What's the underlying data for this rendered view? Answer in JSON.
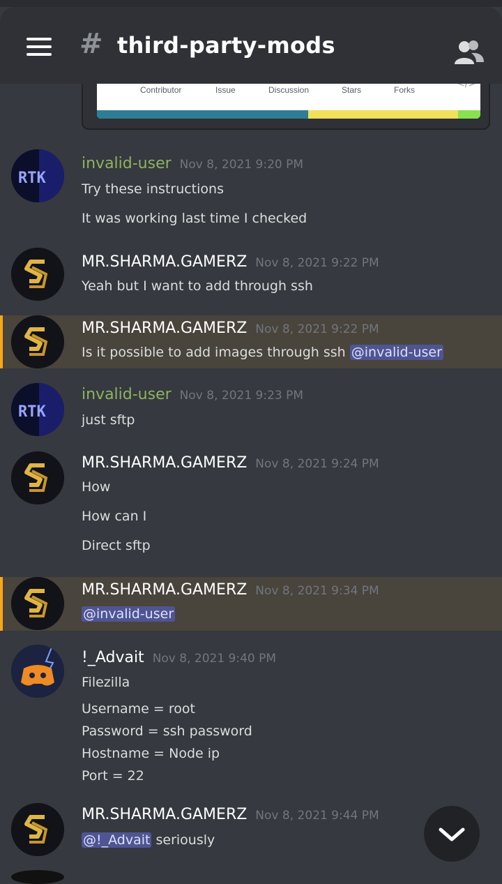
{
  "header": {
    "channel_name": "third-party-mods",
    "menu_icon": "hamburger-menu-icon",
    "channel_icon": "hash-icon",
    "members_icon": "members-icon"
  },
  "embed": {
    "stats": [
      "Contributor",
      "Issue",
      "Discussion",
      "Stars",
      "Forks"
    ],
    "bar_colors": [
      "#2f7d95",
      "#f1e05a",
      "#89e051"
    ]
  },
  "messages": [
    {
      "username": "invalid-user",
      "timestamp": "Nov 8, 2021 9:20 PM",
      "lines": [
        "Try these instructions",
        "It was working last time I checked"
      ]
    },
    {
      "username": "MR.SHARMA.GAMERZ",
      "timestamp": "Nov 8, 2021 9:22 PM",
      "lines": [
        "Yeah but I want to add through ssh"
      ]
    },
    {
      "username": "MR.SHARMA.GAMERZ",
      "timestamp": "Nov 8, 2021 9:22 PM",
      "line_prefix": "Is it possible to add images through ssh ",
      "mention": "@invalid-user"
    },
    {
      "username": "invalid-user",
      "timestamp": "Nov 8, 2021 9:23 PM",
      "lines": [
        "just sftp"
      ]
    },
    {
      "username": "MR.SHARMA.GAMERZ",
      "timestamp": "Nov 8, 2021 9:24 PM",
      "lines": [
        "How",
        "How can I",
        "Direct sftp"
      ]
    },
    {
      "username": "MR.SHARMA.GAMERZ",
      "timestamp": "Nov 8, 2021 9:34 PM",
      "mention": "@invalid-user"
    },
    {
      "username": "!_Advait",
      "timestamp": "Nov 8, 2021 9:40 PM",
      "lines": [
        "Filezilla",
        "Username = root",
        "Password = ssh password",
        "Hostname = Node ip",
        "Port = 22"
      ]
    },
    {
      "username": "MR.SHARMA.GAMERZ",
      "timestamp": "Nov 8, 2021 9:44 PM",
      "mention": "@!_Advait",
      "line_suffix": " seriously"
    }
  ],
  "colors": {
    "background": "#36393f",
    "invalid_user_name": "#8fb35f",
    "default_name": "#ffffff",
    "mention_highlight": "#49443c",
    "mention_bar": "#faa61a"
  },
  "scroll_button_icon": "chevron-down-icon"
}
